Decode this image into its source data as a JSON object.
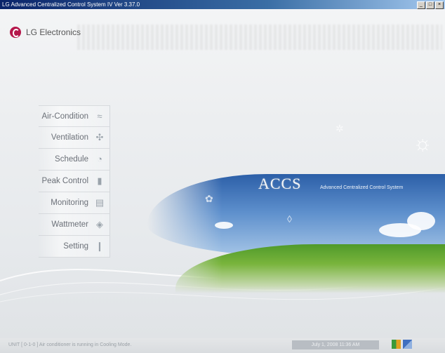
{
  "window": {
    "title": "LG Advanced Centralized Control System IV Ver 3.37.0",
    "min": "_",
    "max": "□",
    "close": "×"
  },
  "brand": {
    "name": "LG Electronics"
  },
  "menu": {
    "items": [
      {
        "label": "Air-Condition",
        "icon": "air-conditioner-icon",
        "glyph": "≈"
      },
      {
        "label": "Ventilation",
        "icon": "ventilation-icon",
        "glyph": "✣"
      },
      {
        "label": "Schedule",
        "icon": "schedule-icon",
        "glyph": "◔"
      },
      {
        "label": "Peak Control",
        "icon": "peak-control-icon",
        "glyph": "▮"
      },
      {
        "label": "Monitoring",
        "icon": "monitoring-icon",
        "glyph": "▤"
      },
      {
        "label": "Wattmeter",
        "icon": "wattmeter-icon",
        "glyph": "◈"
      },
      {
        "label": "Setting",
        "icon": "setting-icon",
        "glyph": "❙"
      }
    ]
  },
  "banner": {
    "logo_text": "ACCS",
    "subtitle": "Advanced Centralized Control System"
  },
  "status": {
    "message": "UNIT [ 0-1-0 ] Air conditioner is running in Cooling Mode.",
    "datetime": "July 1, 2008 11:36 AM"
  },
  "colors": {
    "accent": "#b5174b",
    "titlebar": "#0a246a",
    "sky": "#2c5fa8",
    "grass": "#4f9a2a"
  }
}
